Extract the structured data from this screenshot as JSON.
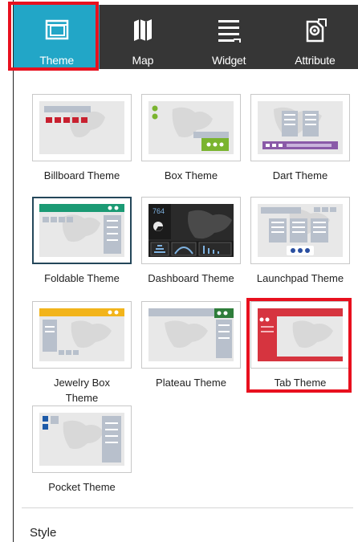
{
  "tabs": [
    {
      "label": "Theme",
      "icon": "theme-icon",
      "active": true
    },
    {
      "label": "Map",
      "icon": "map-icon",
      "active": false
    },
    {
      "label": "Widget",
      "icon": "widget-icon",
      "active": false
    },
    {
      "label": "Attribute",
      "icon": "attribute-icon",
      "active": false
    }
  ],
  "themes": [
    {
      "name": "Billboard Theme",
      "selected": false
    },
    {
      "name": "Box Theme",
      "selected": false
    },
    {
      "name": "Dart Theme",
      "selected": false
    },
    {
      "name": "Foldable Theme",
      "selected": true
    },
    {
      "name": "Dashboard Theme",
      "selected": false
    },
    {
      "name": "Launchpad Theme",
      "selected": false
    },
    {
      "name": "Jewelry Box Theme",
      "selected": false
    },
    {
      "name": "Plateau Theme",
      "selected": false
    },
    {
      "name": "Tab Theme",
      "selected": false
    },
    {
      "name": "Pocket Theme",
      "selected": false
    }
  ],
  "dashboard_thumb_number": "764",
  "style_section": {
    "label": "Style"
  },
  "colors": {
    "tabbar_bg": "#363636",
    "active_tab": "#22a6c7",
    "highlight": "#e8101e",
    "billboard_accent": "#c8202f",
    "box_accent": "#7ab42f",
    "dart_accent": "#8a5aa8",
    "foldable_accent": "#1b9a74",
    "launchpad_accent": "#2a4fa0",
    "jewelry_accent": "#f2b41b",
    "plateau_accent": "#2e7d3a",
    "tab_accent": "#d6343f",
    "pocket_accent": "#1d5aa8"
  }
}
